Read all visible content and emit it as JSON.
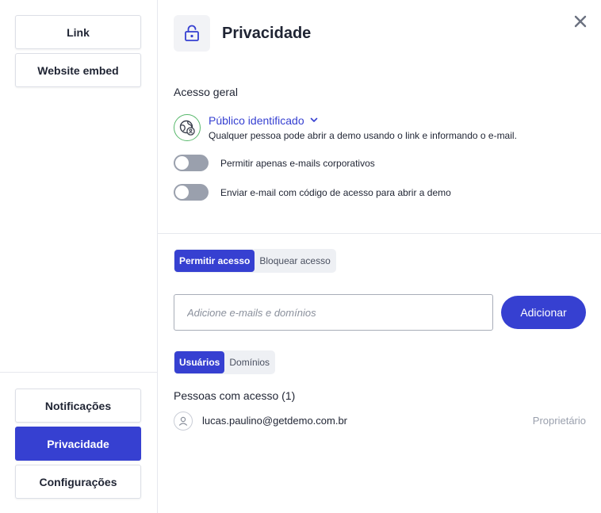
{
  "sidebar": {
    "top_items": [
      {
        "label": "Link"
      },
      {
        "label": "Website embed"
      }
    ],
    "bottom_items": [
      {
        "label": "Notificações",
        "active": false
      },
      {
        "label": "Privacidade",
        "active": true
      },
      {
        "label": "Configurações",
        "active": false
      }
    ]
  },
  "header": {
    "title": "Privacidade",
    "icon": "unlock-icon",
    "close_icon": "close-icon"
  },
  "general_access": {
    "title": "Acesso geral",
    "selected": "Público identificado",
    "description": "Qualquer pessoa pode abrir a demo usando o link e informando o e-mail.",
    "icon": "globe-user-icon",
    "toggles": [
      {
        "label": "Permitir apenas e-mails corporativos",
        "on": false
      },
      {
        "label": "Enviar e-mail com código de acesso para abrir a demo",
        "on": false
      }
    ]
  },
  "access_mode": {
    "options": [
      "Permitir acesso",
      "Bloquear acesso"
    ],
    "selected": "Permitir acesso"
  },
  "add_input": {
    "placeholder": "Adicione e-mails e domínios",
    "value": "",
    "button_label": "Adicionar"
  },
  "list_filter": {
    "options": [
      "Usuários",
      "Domínios"
    ],
    "selected": "Usuários"
  },
  "people": {
    "title": "Pessoas com acesso (1)",
    "items": [
      {
        "email": "lucas.paulino@getdemo.com.br",
        "role": "Proprietário"
      }
    ]
  },
  "colors": {
    "accent": "#3640d1",
    "toggle_off": "#9aa0ad",
    "globe_border": "#57b86b"
  }
}
